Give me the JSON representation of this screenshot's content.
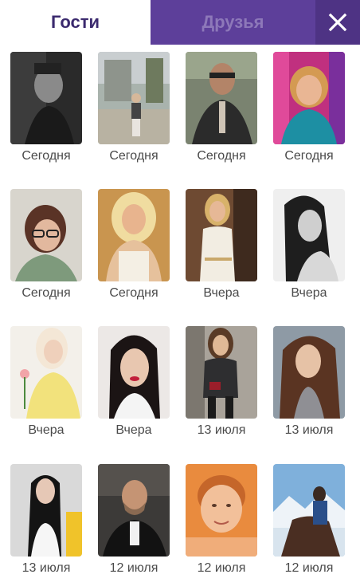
{
  "tabs": {
    "guests": "Гости",
    "friends": "Друзья"
  },
  "close_icon": "close-icon",
  "colors": {
    "active_tab_text": "#3b2a6e",
    "inactive_tab_bg": "#5d3f9a",
    "close_bg": "#4e3384"
  },
  "guests": [
    {
      "date": "Сегодня"
    },
    {
      "date": "Сегодня"
    },
    {
      "date": "Сегодня"
    },
    {
      "date": "Сегодня"
    },
    {
      "date": "Сегодня"
    },
    {
      "date": "Сегодня"
    },
    {
      "date": "Вчера"
    },
    {
      "date": "Вчера"
    },
    {
      "date": "Вчера"
    },
    {
      "date": "Вчера"
    },
    {
      "date": "13 июля"
    },
    {
      "date": "13 июля"
    },
    {
      "date": "13 июля"
    },
    {
      "date": "12 июля"
    },
    {
      "date": "12 июля"
    },
    {
      "date": "12 июля"
    }
  ]
}
